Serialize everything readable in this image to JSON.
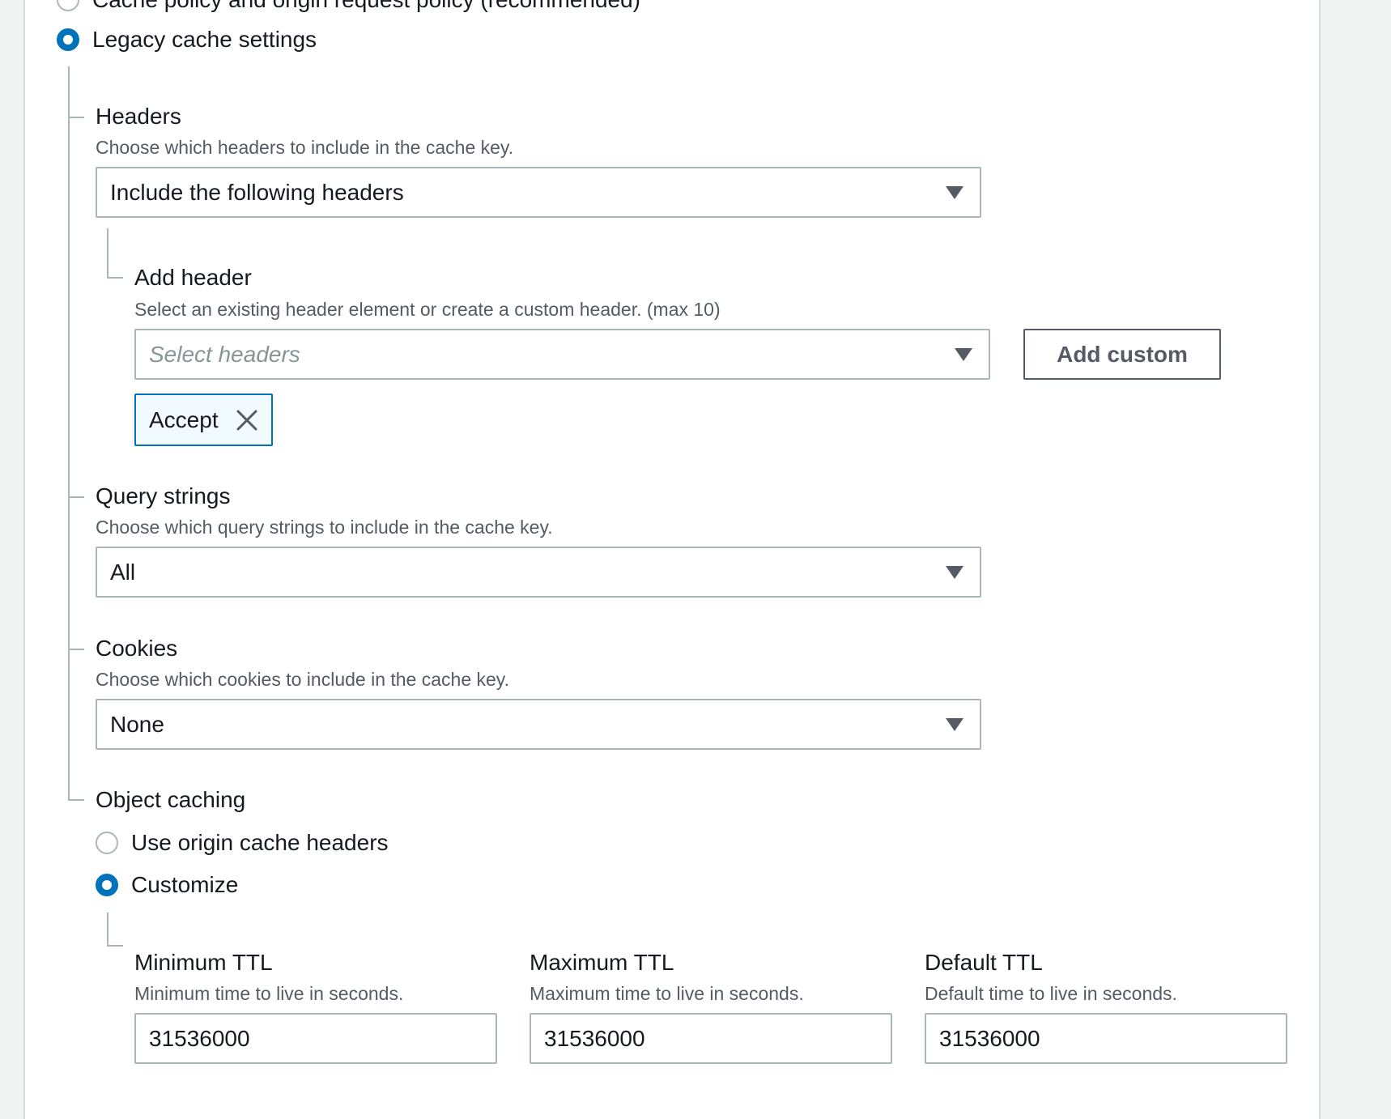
{
  "cache_key_options": {
    "policy_option_label": "Cache policy and origin request policy (recommended)",
    "legacy_option_label": "Legacy cache settings"
  },
  "headers": {
    "title": "Headers",
    "description": "Choose which headers to include in the cache key.",
    "selected": "Include the following headers",
    "add_header": {
      "title": "Add header",
      "description": "Select an existing header element or create a custom header. (max 10)",
      "placeholder": "Select headers",
      "add_custom_label": "Add custom",
      "tokens": [
        "Accept"
      ]
    }
  },
  "query_strings": {
    "title": "Query strings",
    "description": "Choose which query strings to include in the cache key.",
    "selected": "All"
  },
  "cookies": {
    "title": "Cookies",
    "description": "Choose which cookies to include in the cache key.",
    "selected": "None"
  },
  "object_caching": {
    "title": "Object caching",
    "origin_option_label": "Use origin cache headers",
    "customize_option_label": "Customize",
    "min_ttl": {
      "title": "Minimum TTL",
      "description": "Minimum time to live in seconds.",
      "value": "31536000"
    },
    "max_ttl": {
      "title": "Maximum TTL",
      "description": "Maximum time to live in seconds.",
      "value": "31536000"
    },
    "default_ttl": {
      "title": "Default TTL",
      "description": "Default time to live in seconds.",
      "value": "31536000"
    }
  },
  "colors": {
    "accent": "#0073bb",
    "border": "#aab7b8",
    "text": "#16191f",
    "secondary_text": "#545b64"
  }
}
